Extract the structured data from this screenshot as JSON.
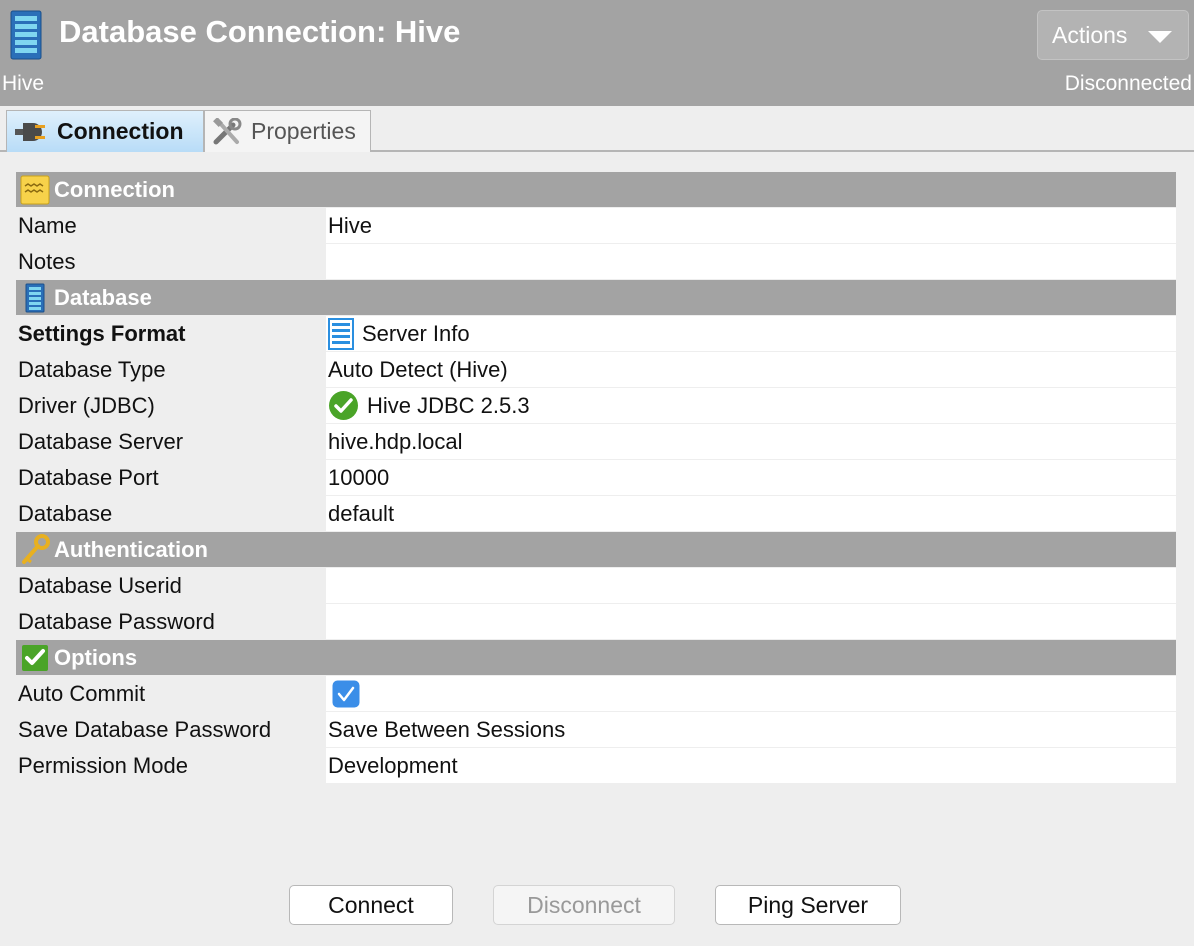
{
  "header": {
    "title": "Database Connection: Hive",
    "subtitle": "Hive",
    "status": "Disconnected",
    "actions_label": "Actions"
  },
  "tabs": [
    {
      "label": "Connection",
      "active": true,
      "icon": "plug-icon"
    },
    {
      "label": "Properties",
      "active": false,
      "icon": "tools-icon"
    }
  ],
  "sections": {
    "connection": {
      "title": "Connection",
      "icon": "notepad-icon",
      "rows": [
        {
          "label": "Name",
          "value": "Hive"
        },
        {
          "label": "Notes",
          "value": ""
        }
      ]
    },
    "database": {
      "title": "Database",
      "icon": "database-icon",
      "rows": [
        {
          "label": "Settings Format",
          "value": "Server Info",
          "icon": "server-info-icon"
        },
        {
          "label": "Database Type",
          "value": "Auto Detect (Hive)"
        },
        {
          "label": "Driver (JDBC)",
          "value": "Hive JDBC 2.5.3",
          "icon": "check-circle-icon"
        },
        {
          "label": "Database Server",
          "value": "hive.hdp.local"
        },
        {
          "label": "Database Port",
          "value": "10000"
        },
        {
          "label": "Database",
          "value": "default"
        }
      ]
    },
    "authentication": {
      "title": "Authentication",
      "icon": "key-icon",
      "rows": [
        {
          "label": "Database Userid",
          "value": ""
        },
        {
          "label": "Database Password",
          "value": ""
        }
      ]
    },
    "options": {
      "title": "Options",
      "icon": "check-box-icon",
      "rows": [
        {
          "label": "Auto Commit",
          "value": true
        },
        {
          "label": "Save Database Password",
          "value": "Save Between Sessions"
        },
        {
          "label": "Permission Mode",
          "value": "Development"
        }
      ]
    }
  },
  "buttons": {
    "connect": "Connect",
    "disconnect": "Disconnect",
    "ping": "Ping Server"
  },
  "colors": {
    "header_bg": "#a3a3a3",
    "section_bg": "#a3a3a3",
    "accent_blue": "#3b8ee8",
    "check_green": "#4aa428"
  }
}
